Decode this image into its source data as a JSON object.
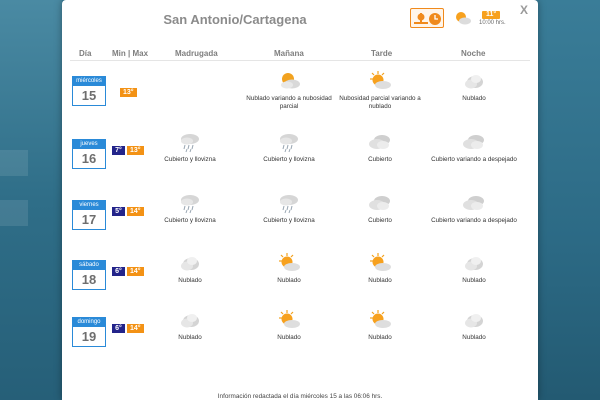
{
  "modal": {
    "title": "San Antonio/Cartagena",
    "close_label": "X",
    "current": {
      "temp": "11°",
      "time": "10:00 hrs.",
      "icon": "partly-cloudy-icon"
    },
    "footer": "Información redactada el día miércoles 15 a las 06:06 hrs."
  },
  "headers": {
    "dia": "Día",
    "minmax": "Min | Max",
    "madrugada": "Madrugada",
    "manana": "Mañana",
    "tarde": "Tarde",
    "noche": "Noche"
  },
  "colors": {
    "accent": "#2a8ad8",
    "min": "#23248a",
    "max": "#f39215",
    "orange_btn": "#f08a1c"
  },
  "days": [
    {
      "name": "miércoles",
      "num": "15",
      "min": "",
      "max": "13°",
      "madrugada": {
        "icon": "",
        "label": ""
      },
      "manana": {
        "icon": "partly-cloudy-icon",
        "label": "Nublado variando a nubosidad parcial"
      },
      "tarde": {
        "icon": "sun-cloud-icon",
        "label": "Nubosidad parcial variando a nublado"
      },
      "noche": {
        "icon": "moon-cloud-icon",
        "label": "Nublado"
      }
    },
    {
      "name": "jueves",
      "num": "16",
      "min": "7°",
      "max": "13°",
      "madrugada": {
        "icon": "drizzle-icon",
        "label": "Cubierto y llovizna"
      },
      "manana": {
        "icon": "drizzle-icon",
        "label": "Cubierto y llovizna"
      },
      "tarde": {
        "icon": "overcast-icon",
        "label": "Cubierto"
      },
      "noche": {
        "icon": "overcast-icon",
        "label": "Cubierto variando a despejado"
      }
    },
    {
      "name": "viernes",
      "num": "17",
      "min": "5°",
      "max": "14°",
      "madrugada": {
        "icon": "drizzle-icon",
        "label": "Cubierto y llovizna"
      },
      "manana": {
        "icon": "drizzle-icon",
        "label": "Cubierto y llovizna"
      },
      "tarde": {
        "icon": "overcast-icon",
        "label": "Cubierto"
      },
      "noche": {
        "icon": "overcast-icon",
        "label": "Cubierto variando a despejado"
      }
    },
    {
      "name": "sábado",
      "num": "18",
      "min": "6°",
      "max": "14°",
      "madrugada": {
        "icon": "moon-cloud-icon",
        "label": "Nublado"
      },
      "manana": {
        "icon": "sun-cloud-icon",
        "label": "Nublado"
      },
      "tarde": {
        "icon": "sun-cloud-icon",
        "label": "Nublado"
      },
      "noche": {
        "icon": "moon-cloud-icon",
        "label": "Nublado"
      }
    },
    {
      "name": "domingo",
      "num": "19",
      "min": "6°",
      "max": "14°",
      "madrugada": {
        "icon": "moon-cloud-icon",
        "label": "Nublado"
      },
      "manana": {
        "icon": "sun-cloud-icon",
        "label": "Nublado"
      },
      "tarde": {
        "icon": "sun-cloud-icon",
        "label": "Nublado"
      },
      "noche": {
        "icon": "moon-cloud-icon",
        "label": "Nublado"
      }
    }
  ]
}
